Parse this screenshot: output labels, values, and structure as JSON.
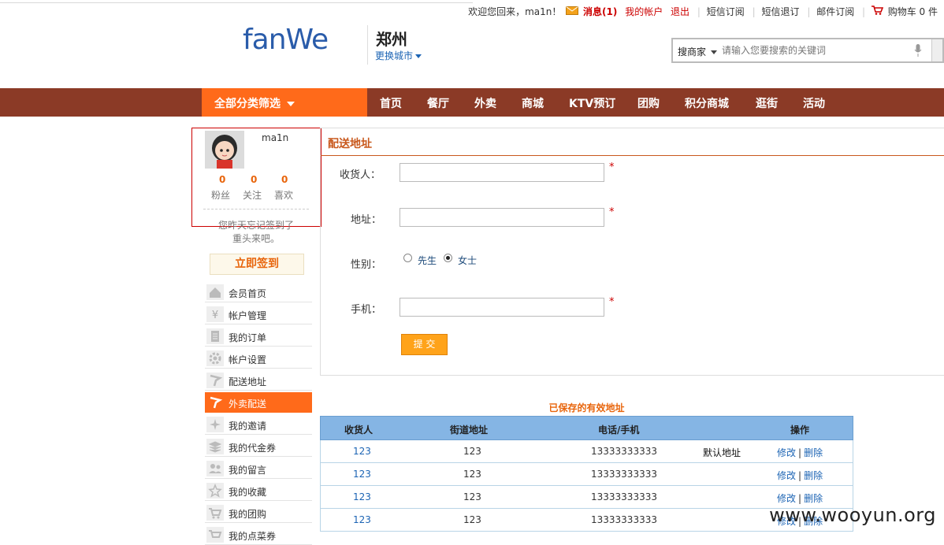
{
  "topbar": {
    "welcome": "欢迎您回来，ma1n！",
    "messages": "消息(1)",
    "my_account": "我的帐户",
    "logout": "退出",
    "sms_subscribe": "短信订阅",
    "sms_unsubscribe": "短信退订",
    "email_subscribe": "邮件订阅",
    "cart": "购物车 0 件"
  },
  "header": {
    "logo": "fanWe",
    "city": "郑州",
    "change_city": "更换城市"
  },
  "search": {
    "category": "搜商家",
    "placeholder": "请输入您要搜索的关键词"
  },
  "nav": {
    "all_categories": "全部分类筛选",
    "items": [
      "首页",
      "餐厅",
      "外卖",
      "商城",
      "KTV预订",
      "团购",
      "积分商城",
      "逛街",
      "活动"
    ]
  },
  "user": {
    "name": "ma1n",
    "stats": [
      {
        "value": "0",
        "label": "粉丝"
      },
      {
        "value": "0",
        "label": "关注"
      },
      {
        "value": "0",
        "label": "喜欢"
      }
    ],
    "sign_hint_1": "您昨天忘记签到了",
    "sign_hint_2": "重头来吧。",
    "sign_button": "立即签到"
  },
  "menu": {
    "items": [
      "会员首页",
      "帐户管理",
      "我的订单",
      "帐户设置",
      "配送地址",
      "外卖配送",
      "我的邀请",
      "我的代金券",
      "我的留言",
      "我的收藏",
      "我的团购",
      "我的点菜券"
    ],
    "active": "外卖配送"
  },
  "form": {
    "title": "配送地址",
    "receiver_label": "收货人：",
    "address_label": "地址：",
    "gender_label": "性别：",
    "gender_male": "先生",
    "gender_female": "女士",
    "gender_selected": "女士",
    "phone_label": "手机：",
    "required_mark": "*",
    "submit": "提 交"
  },
  "saved": {
    "title": "已保存的有效地址",
    "headers": [
      "收货人",
      "街道地址",
      "电话/手机",
      "操作"
    ],
    "rows": [
      {
        "receiver": "123",
        "street": "123",
        "phone": "13333333333",
        "default": "默认地址",
        "edit": "修改",
        "delete": "删除"
      },
      {
        "receiver": "123",
        "street": "123",
        "phone": "13333333333",
        "default": "",
        "edit": "修改",
        "delete": "删除"
      },
      {
        "receiver": "123",
        "street": "123",
        "phone": "13333333333",
        "default": "",
        "edit": "修改",
        "delete": "删除"
      },
      {
        "receiver": "123",
        "street": "123",
        "phone": "13333333333",
        "default": "",
        "edit": "修改",
        "delete": "删除"
      }
    ]
  },
  "watermark": "www.wooyun.org",
  "colors": {
    "nav_bg": "#8b3a26",
    "accent_orange": "#ff6a1a",
    "table_header": "#85b5e4",
    "title_orange": "#c8581c"
  }
}
